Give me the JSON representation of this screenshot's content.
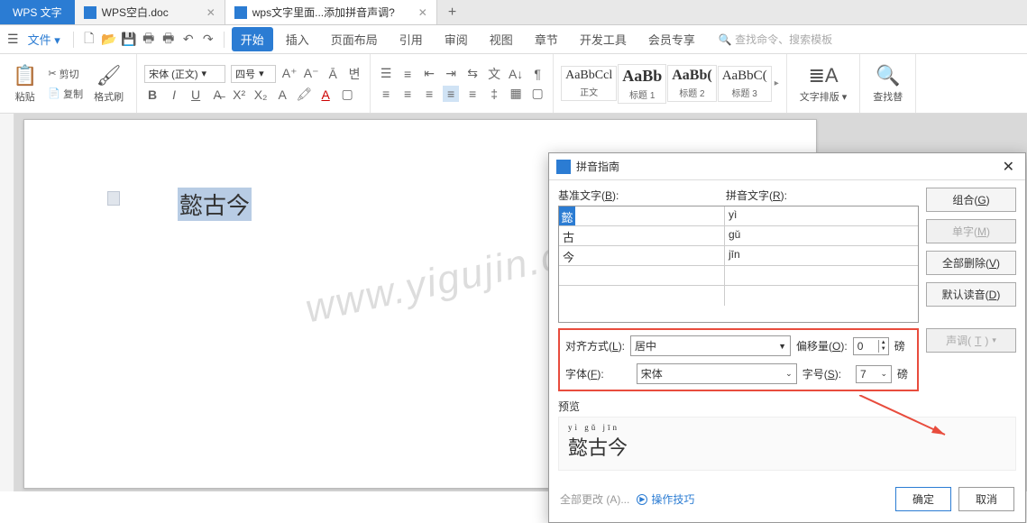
{
  "app_title": "WPS 文字",
  "tabs": [
    {
      "label": "WPS空白.doc",
      "active": false
    },
    {
      "label": "wps文字里面...添加拼音声调?",
      "active": true
    }
  ],
  "tab_add": "+",
  "file_menu": "文件",
  "menus": [
    "开始",
    "插入",
    "页面布局",
    "引用",
    "审阅",
    "视图",
    "章节",
    "开发工具",
    "会员专享"
  ],
  "search_placeholder": "查找命令、搜索模板",
  "clipboard": {
    "paste": "粘贴",
    "cut": "剪切",
    "copy": "复制",
    "brush": "格式刷"
  },
  "font": {
    "family": "宋体 (正文)",
    "size": "四号"
  },
  "styles": [
    {
      "text": "AaBbCcl",
      "label": "正文",
      "weight": "normal"
    },
    {
      "text": "AaBb",
      "label": "标题 1",
      "weight": "bold"
    },
    {
      "text": "AaBb(",
      "label": "标题 2",
      "weight": "bold"
    },
    {
      "text": "AaBbC(",
      "label": "标题 3",
      "weight": "normal"
    }
  ],
  "text_layout": "文字排版",
  "find_replace": "查找替",
  "doc_text": "懿古今",
  "watermark": "www.yigujin.cn",
  "dialog": {
    "title": "拼音指南",
    "close": "✕",
    "header_base": "基准文字(B):",
    "header_pinyin": "拼音文字(R):",
    "rows": [
      {
        "base": "懿",
        "pinyin": "yì"
      },
      {
        "base": "古",
        "pinyin": "gǔ"
      },
      {
        "base": "今",
        "pinyin": "jīn"
      }
    ],
    "side_buttons": {
      "combine": "组合(G)",
      "single": "单字(M)",
      "delete_all": "全部删除(V)",
      "default": "默认读音(D)",
      "tone": "声调(T)"
    },
    "align_label": "对齐方式(L):",
    "align_value": "居中",
    "offset_label": "偏移量(O):",
    "offset_value": "0",
    "unit_pt": "磅",
    "font_label": "字体(F):",
    "font_value": "宋体",
    "size_label": "字号(S):",
    "size_value": "7",
    "preview_label": "预览",
    "preview_pinyin": "yì gǔ jīn",
    "preview_hanzi": "懿古今",
    "footer_all": "全部更改 (A)...",
    "footer_tips": "操作技巧",
    "ok": "确定",
    "cancel": "取消"
  }
}
